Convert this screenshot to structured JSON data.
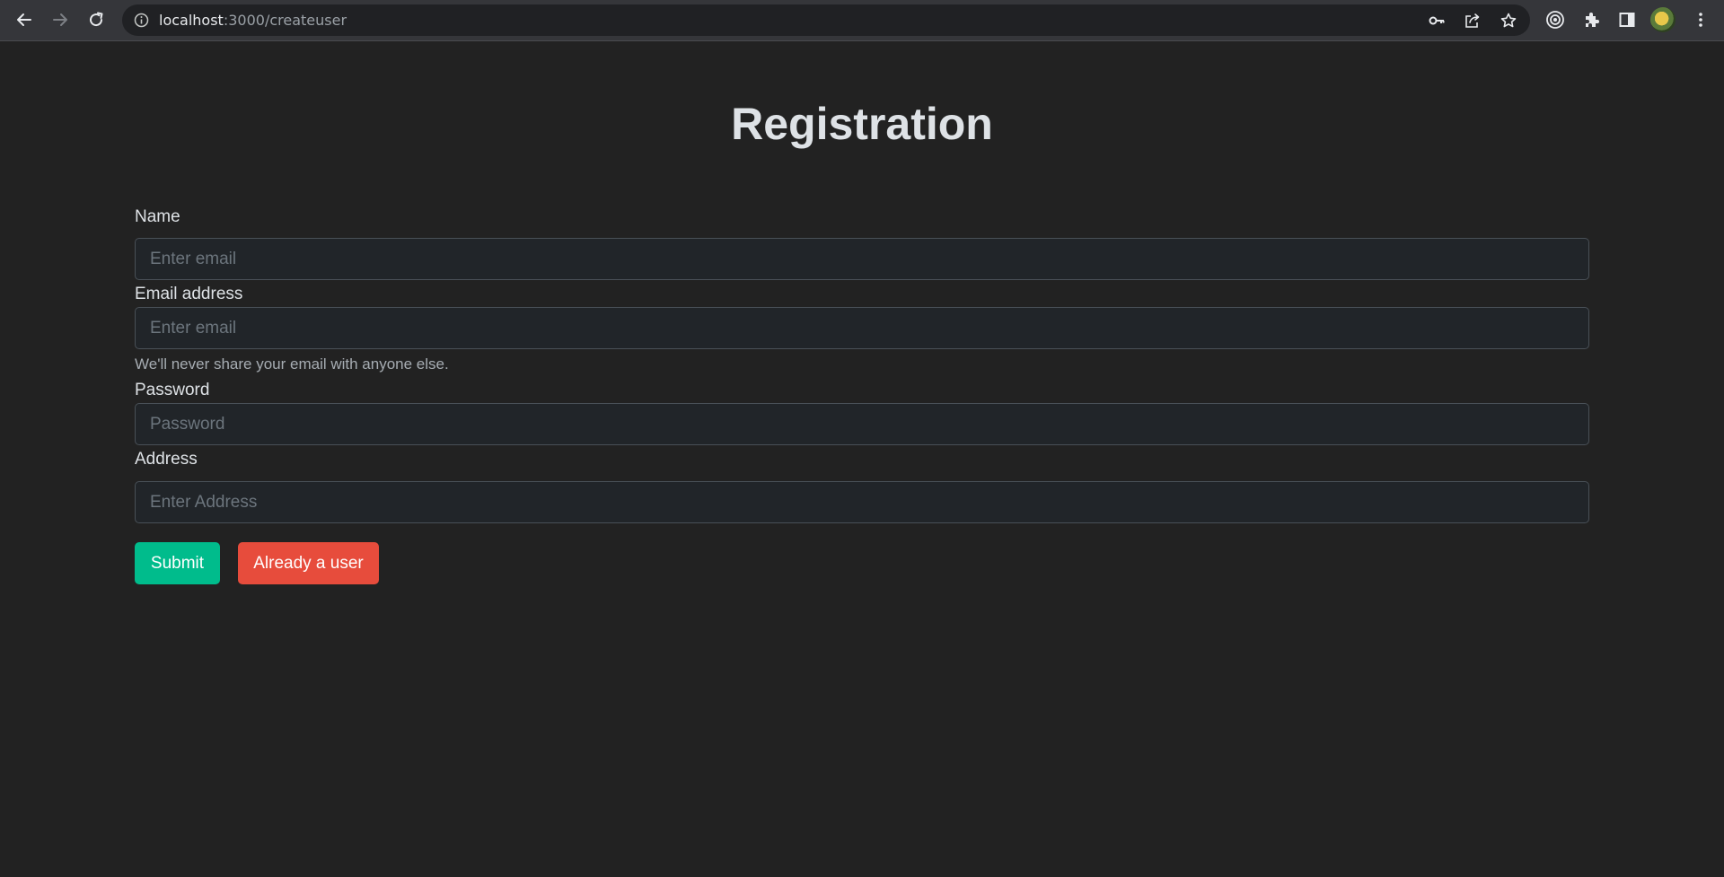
{
  "browser": {
    "url_host": "localhost",
    "url_path": ":3000/createuser"
  },
  "page": {
    "title": "Registration"
  },
  "form": {
    "name": {
      "label": "Name",
      "placeholder": "Enter email",
      "value": ""
    },
    "email": {
      "label": "Email address",
      "placeholder": "Enter email",
      "value": "",
      "help": "We'll never share your email with anyone else."
    },
    "password": {
      "label": "Password",
      "placeholder": "Password",
      "value": ""
    },
    "address": {
      "label": "Address",
      "placeholder": "Enter Address",
      "value": ""
    }
  },
  "buttons": {
    "submit": "Submit",
    "already_user": "Already a user"
  },
  "colors": {
    "background": "#222222",
    "submit": "#00bc8c",
    "already_user": "#e74c3c"
  },
  "icons": [
    "back-icon",
    "forward-icon",
    "reload-icon",
    "info-icon",
    "key-icon",
    "share-icon",
    "star-icon",
    "target-icon",
    "extensions-icon",
    "side-panel-icon",
    "avatar",
    "more-icon"
  ]
}
